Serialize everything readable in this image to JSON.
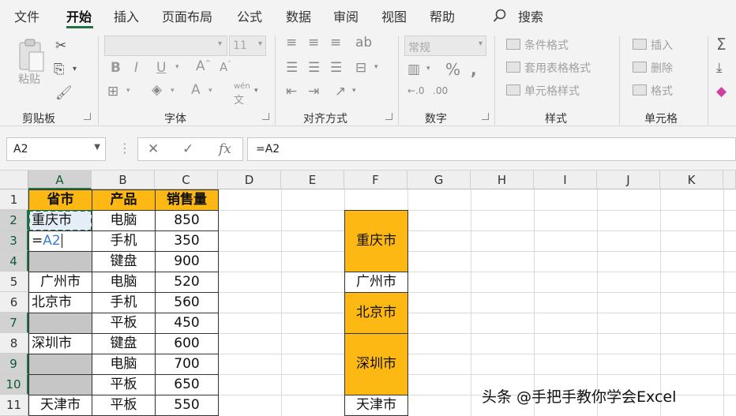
{
  "menu": {
    "items": [
      "文件",
      "开始",
      "插入",
      "页面布局",
      "公式",
      "数据",
      "审阅",
      "视图",
      "帮助"
    ],
    "search": "搜索"
  },
  "ribbon": {
    "groups": [
      "剪贴板",
      "字体",
      "对齐方式",
      "数字",
      "样式",
      "单元格"
    ],
    "paste": "粘贴",
    "font_size": "11",
    "number_format": "常规",
    "styles": [
      "条件格式",
      "套用表格格式",
      "单元格样式"
    ],
    "cells": [
      "插入",
      "删除",
      "格式"
    ],
    "wen": "wén"
  },
  "formula_bar": {
    "name_box": "A2",
    "formula": "=A2"
  },
  "columns": [
    "A",
    "B",
    "C",
    "D",
    "E",
    "F",
    "G",
    "H",
    "I",
    "J",
    "K"
  ],
  "rows": [
    "1",
    "2",
    "3",
    "4",
    "5",
    "6",
    "7",
    "8",
    "9",
    "10",
    "11"
  ],
  "table": {
    "headers": [
      "省市",
      "产品",
      "销售量"
    ],
    "rows": [
      {
        "province": "重庆市",
        "product": "电脑",
        "sales": "850"
      },
      {
        "province": "=A2",
        "product": "手机",
        "sales": "350"
      },
      {
        "province": "",
        "product": "键盘",
        "sales": "900"
      },
      {
        "province": "广州市",
        "product": "电脑",
        "sales": "520"
      },
      {
        "province": "北京市",
        "product": "手机",
        "sales": "560"
      },
      {
        "province": "",
        "product": "平板",
        "sales": "450"
      },
      {
        "province": "深圳市",
        "product": "键盘",
        "sales": "600"
      },
      {
        "province": "",
        "product": "电脑",
        "sales": "700"
      },
      {
        "province": "",
        "product": "平板",
        "sales": "650"
      },
      {
        "province": "天津市",
        "product": "平板",
        "sales": "550"
      }
    ]
  },
  "merged": [
    "重庆市",
    "广州市",
    "北京市",
    "深圳市",
    "天津市"
  ],
  "watermark": "头条 @手把手教你学会Excel",
  "colors": {
    "accent": "#217346",
    "header_fill": "#fdb813",
    "gray_fill": "#c6c6c6"
  }
}
